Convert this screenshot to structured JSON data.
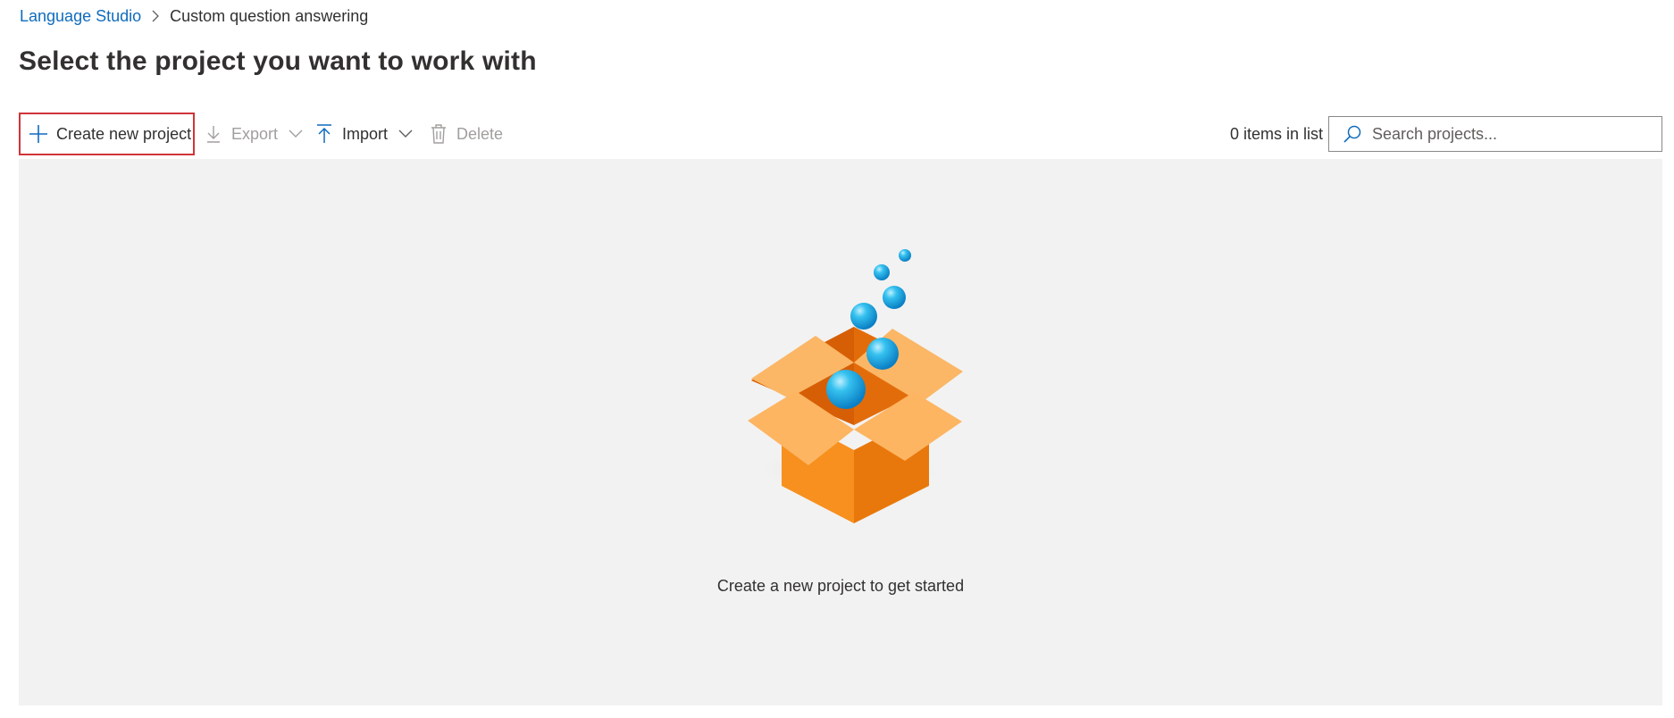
{
  "breadcrumb": {
    "root": "Language Studio",
    "current": "Custom question answering"
  },
  "page": {
    "title": "Select the project you want to work with"
  },
  "toolbar": {
    "create_label": "Create new project",
    "export_label": "Export",
    "import_label": "Import",
    "delete_label": "Delete",
    "items_count": "0 items in list"
  },
  "search": {
    "placeholder": "Search projects...",
    "value": ""
  },
  "empty_state": {
    "message": "Create a new project to get started",
    "illustration": "open-box-with-bubbles"
  },
  "colors": {
    "accent": "#0f6cbd",
    "highlight_border": "#d13438",
    "panel_bg": "#f2f2f2",
    "box_orange": "#f7901e",
    "bubble_blue": "#1aa7e0"
  }
}
